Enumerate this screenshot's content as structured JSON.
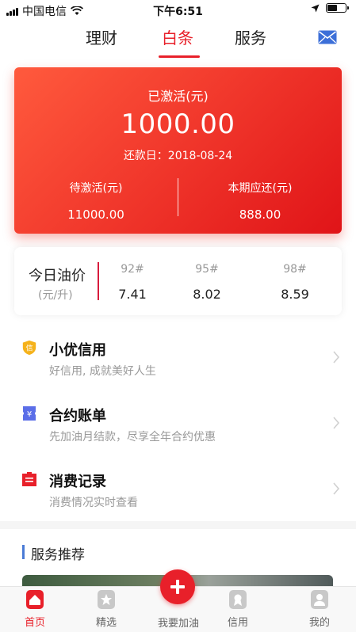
{
  "status_bar": {
    "carrier": "中国电信",
    "time": "下午6:51",
    "battery_level": 0.55
  },
  "top_tabs": [
    {
      "label": "理财",
      "active": false
    },
    {
      "label": "白条",
      "active": true
    },
    {
      "label": "服务",
      "active": false
    }
  ],
  "account_card": {
    "activated_label": "已激活(元)",
    "activated_amount": "1000.00",
    "due_date_text": "还款日：2018-08-24",
    "pending_label": "待激活(元)",
    "pending_amount": "11000.00",
    "current_due_label": "本期应还(元)",
    "current_due_amount": "888.00"
  },
  "oil_prices": {
    "title": "今日油价",
    "unit": "(元/升)",
    "grades": [
      {
        "grade": "92#",
        "price": "7.41"
      },
      {
        "grade": "95#",
        "price": "8.02"
      },
      {
        "grade": "98#",
        "price": "8.59"
      }
    ]
  },
  "menu_items": [
    {
      "title": "小优信用",
      "subtitle": "好信用, 成就美好人生",
      "icon": "credit-shield-icon",
      "icon_text": "信"
    },
    {
      "title": "合约账单",
      "subtitle": "先加油月结款，尽享全年合约优惠",
      "icon": "contract-bill-icon",
      "icon_text": "¥"
    },
    {
      "title": "消费记录",
      "subtitle": "消费情况实时查看",
      "icon": "consumption-record-icon",
      "icon_text": ""
    }
  ],
  "section": {
    "title": "服务推荐"
  },
  "bottom_tabs": [
    {
      "label": "首页",
      "active": true
    },
    {
      "label": "精选",
      "active": false
    },
    {
      "label": "我要加油",
      "active": false
    },
    {
      "label": "信用",
      "active": false
    },
    {
      "label": "我的",
      "active": false
    }
  ],
  "colors": {
    "accent": "#e8202a",
    "card_gradient_start": "#ff5a3d",
    "card_gradient_end": "#e01418",
    "mail_icon": "#3c6fd8",
    "credit_icon": "#f5b21b",
    "contract_icon": "#5b6ee8",
    "record_icon": "#e8202a"
  }
}
